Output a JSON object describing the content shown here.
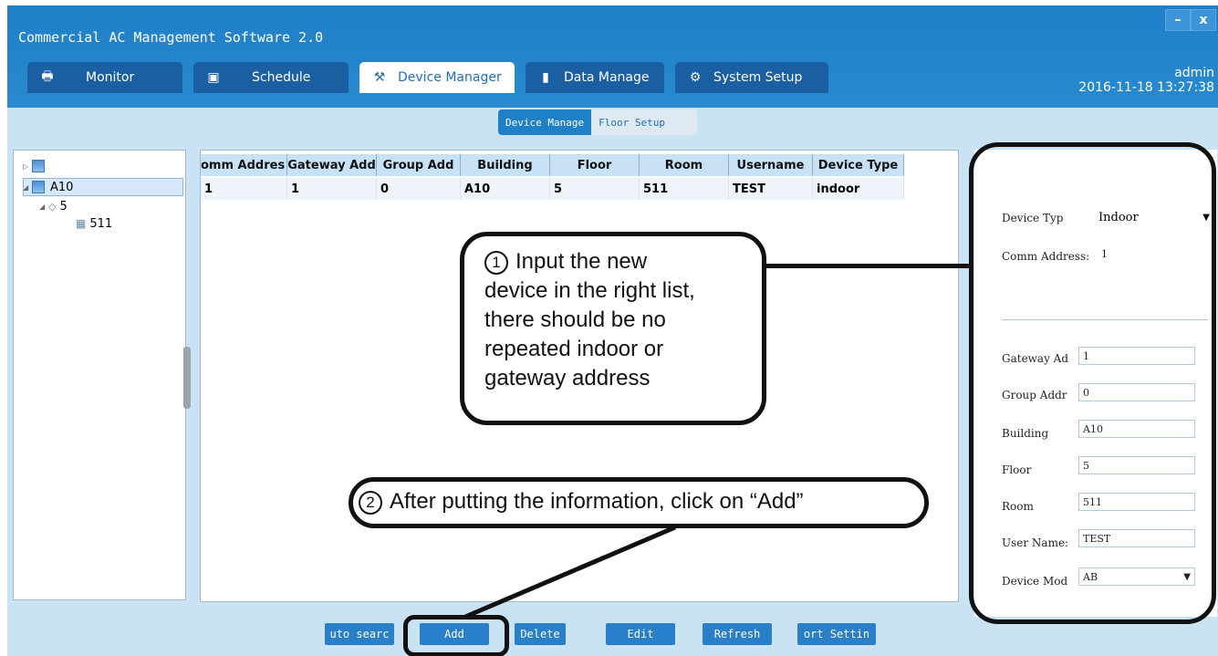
{
  "app": {
    "title": "Commercial AC Management Software 2.0",
    "minimize_label": "–",
    "close_label": "x"
  },
  "tabs": [
    {
      "label": "Monitor",
      "icon": "printer-icon"
    },
    {
      "label": "Schedule",
      "icon": "calendar-icon"
    },
    {
      "label": "Device Manager",
      "icon": "wrench-icon"
    },
    {
      "label": "Data Manage",
      "icon": "bar-chart-icon"
    },
    {
      "label": "System Setup",
      "icon": "gear-icon"
    }
  ],
  "user": {
    "name": "admin",
    "datetime": "2016-11-18 13:27:38"
  },
  "subtabs": [
    "Device Manage",
    "Floor Setup"
  ],
  "tree": {
    "building": "A10",
    "floor": "5",
    "room": "511"
  },
  "grid": {
    "columns": [
      "omm Addres",
      "Gateway Add",
      "Group Add",
      "Building",
      "Floor",
      "Room",
      "Username",
      "Device Type"
    ],
    "rows": [
      [
        "1",
        "1",
        "0",
        "A10",
        "5",
        "511",
        "TEST",
        "indoor"
      ]
    ]
  },
  "form": {
    "device_type_label": "Device Typ",
    "device_type_value": "Indoor",
    "comm_address_label": "Comm Address:",
    "comm_address_value": "1",
    "gateway_label": "Gateway Ad",
    "gateway_value": "1",
    "group_label": "Group Addr",
    "group_value": "0",
    "building_label": "Building",
    "building_value": "A10",
    "floor_label": "Floor",
    "floor_value": "5",
    "room_label": "Room",
    "room_value": "511",
    "username_label": "User Name:",
    "username_value": "TEST",
    "device_model_label": "Device Mod",
    "device_model_value": "AB"
  },
  "buttons": [
    "uto searc",
    "Add",
    "Delete",
    "Edit",
    "Refresh",
    "ort Settin"
  ],
  "annotations": {
    "step1_num": "1",
    "step1_lines": [
      "Input the new",
      "device in the right list,",
      "there should be no",
      "repeated indoor or",
      "gateway address"
    ],
    "step2_num": "2",
    "step2_text": "After putting the information, click on “Add”"
  }
}
